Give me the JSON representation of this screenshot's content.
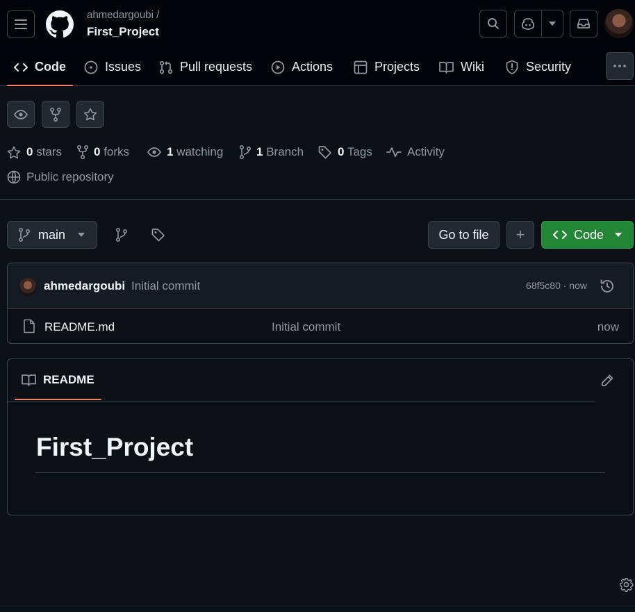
{
  "header": {
    "owner": "ahmedargoubi /",
    "repo": "First_Project"
  },
  "nav": {
    "tabs": [
      {
        "label": "Code",
        "icon": "code-icon"
      },
      {
        "label": "Issues",
        "icon": "issue-icon"
      },
      {
        "label": "Pull requests",
        "icon": "pull-request-icon"
      },
      {
        "label": "Actions",
        "icon": "play-icon"
      },
      {
        "label": "Projects",
        "icon": "table-icon"
      },
      {
        "label": "Wiki",
        "icon": "book-icon"
      },
      {
        "label": "Security",
        "icon": "shield-icon"
      }
    ]
  },
  "stats": {
    "stars_count": "0",
    "stars_label": "stars",
    "forks_count": "0",
    "forks_label": "forks",
    "watching_count": "1",
    "watching_label": "watching",
    "branch_count": "1",
    "branch_label": "Branch",
    "tags_count": "0",
    "tags_label": "Tags",
    "activity_label": "Activity",
    "visibility": "Public repository"
  },
  "branchbar": {
    "branch": "main",
    "goto_file": "Go to file",
    "add": "+",
    "code": "Code"
  },
  "commit": {
    "author": "ahmedargoubi",
    "message": "Initial commit",
    "sha_time": "68f5c80 · now"
  },
  "files": [
    {
      "name": "README.md",
      "message": "Initial commit",
      "time": "now"
    }
  ],
  "readme": {
    "tab_label": "README",
    "heading": "First_Project"
  },
  "colors": {
    "background": "#0d1117",
    "header_bg": "#010409",
    "border": "#3d444d",
    "accent_underline": "#f78166",
    "green_button": "#238636"
  }
}
